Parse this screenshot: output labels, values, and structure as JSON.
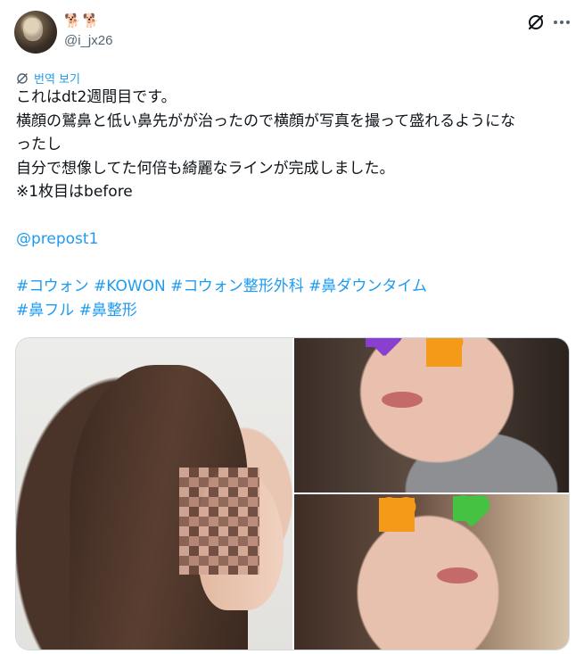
{
  "author": {
    "display_name_emoji": [
      "🐕",
      "🐕"
    ],
    "handle": "@i_jx26"
  },
  "header_actions": {
    "grok_icon": "grok-icon",
    "more_icon": "more-horizontal-icon"
  },
  "translate": {
    "label": "번역 보기",
    "icon": "translate-icon"
  },
  "tweet": {
    "lines": [
      "これはdt2週間目です。",
      "横顔の鷲鼻と低い鼻先がが治ったので横顔が写真を撮って盛れるようにな",
      "ったし",
      "自分で想像してた何倍も綺麗なラインが完成しました。",
      "※1枚目はbefore"
    ],
    "mention": "@prepost1",
    "hashtags_line1": [
      "#コウォン",
      "#KOWON",
      "#コウォン整形外科",
      "#鼻ダウンタイム"
    ],
    "hashtags_line2": [
      "#鼻フル",
      "#鼻整形"
    ]
  },
  "media": {
    "photos": [
      "photo-before-profile",
      "photo-after-1",
      "photo-after-2"
    ],
    "sticker_colors": {
      "orange": "#f59a18",
      "green": "#46c243",
      "purple": "#8a3fd1"
    }
  },
  "colors": {
    "link": "#1d9bf0",
    "secondary_text": "#536471",
    "text": "#0f1419"
  }
}
